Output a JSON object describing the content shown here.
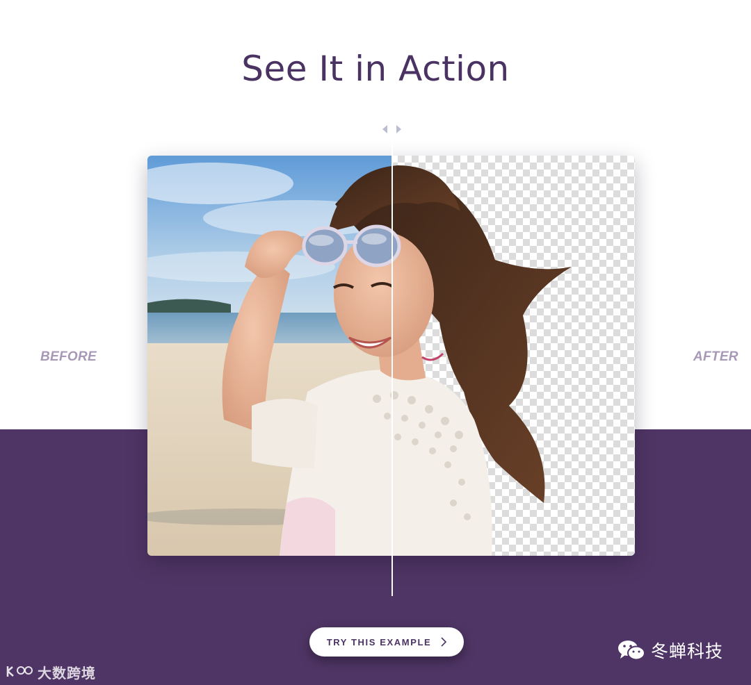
{
  "header": {
    "title": "See It in Action"
  },
  "comparison": {
    "before_label": "BEFORE",
    "after_label": "AFTER",
    "split_fraction": 0.5
  },
  "cta": {
    "label": "TRY THIS EXAMPLE",
    "icon": "chevron-right-icon"
  },
  "watermarks": {
    "left_text": "大数跨境",
    "right_text": "冬蝉科技"
  },
  "colors": {
    "brand_purple": "#4f3565",
    "title": "#4a3262",
    "side_label": "#a898b8"
  }
}
